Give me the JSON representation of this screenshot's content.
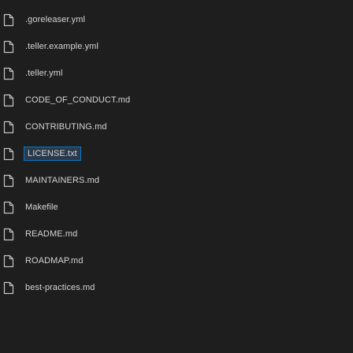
{
  "explorer": {
    "files": [
      {
        "name": ".goreleaser.yml",
        "icon": "file-icon"
      },
      {
        "name": ".teller.example.yml",
        "icon": "file-icon"
      },
      {
        "name": ".teller.yml",
        "icon": "file-icon"
      },
      {
        "name": "CODE_OF_CONDUCT.md",
        "icon": "file-icon"
      },
      {
        "name": "CONTRIBUTING.md",
        "icon": "file-icon"
      },
      {
        "name": "LICENSE.txt",
        "icon": "file-icon",
        "selected": true
      },
      {
        "name": "MAINTAINERS.md",
        "icon": "file-icon"
      },
      {
        "name": "Makefile",
        "icon": "file-icon"
      },
      {
        "name": "README.md",
        "icon": "file-icon"
      },
      {
        "name": "ROADMAP.md",
        "icon": "file-icon"
      },
      {
        "name": "best-practices.md",
        "icon": "file-icon"
      }
    ]
  },
  "colors": {
    "background": "#1e1e1e",
    "text": "#d4d4d4",
    "icon_stroke": "#c5c5c5",
    "selection_border": "#007acc"
  }
}
